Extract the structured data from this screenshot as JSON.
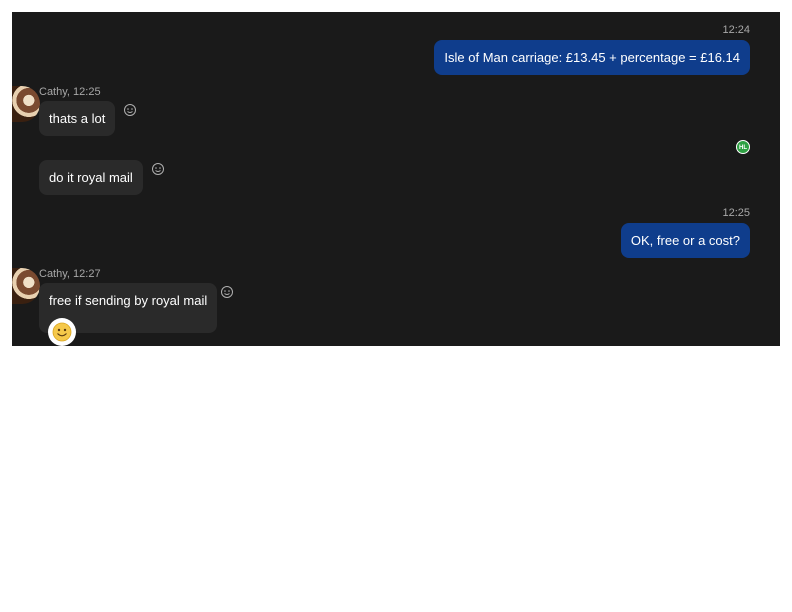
{
  "messages": [
    {
      "direction": "out",
      "time": "12:24",
      "text": "Isle of Man carriage: £13.45 + percentage = £16.14"
    },
    {
      "direction": "in",
      "sender": "Cathy, 12:25",
      "text": "thats a lot"
    },
    {
      "direction": "in",
      "text": "do it royal mail"
    },
    {
      "direction": "out",
      "time": "12:25",
      "text": "OK, free or a cost?"
    },
    {
      "direction": "in",
      "sender": "Cathy, 12:27",
      "text": "free if sending by royal mail",
      "reaction": "smiley-emoji"
    }
  ],
  "read_receipt": {
    "initials": "HL",
    "color": "#2ea043"
  },
  "colors": {
    "background": "#1a1a1a",
    "outgoing_bubble": "#0f3d8c",
    "incoming_bubble": "#2a2a2a",
    "meta_text": "#a8a8a8"
  },
  "icons": {
    "add_reaction": "add-reaction-smiley-icon",
    "avatar": "cathy-avatar",
    "reaction": "smiley-emoji"
  }
}
